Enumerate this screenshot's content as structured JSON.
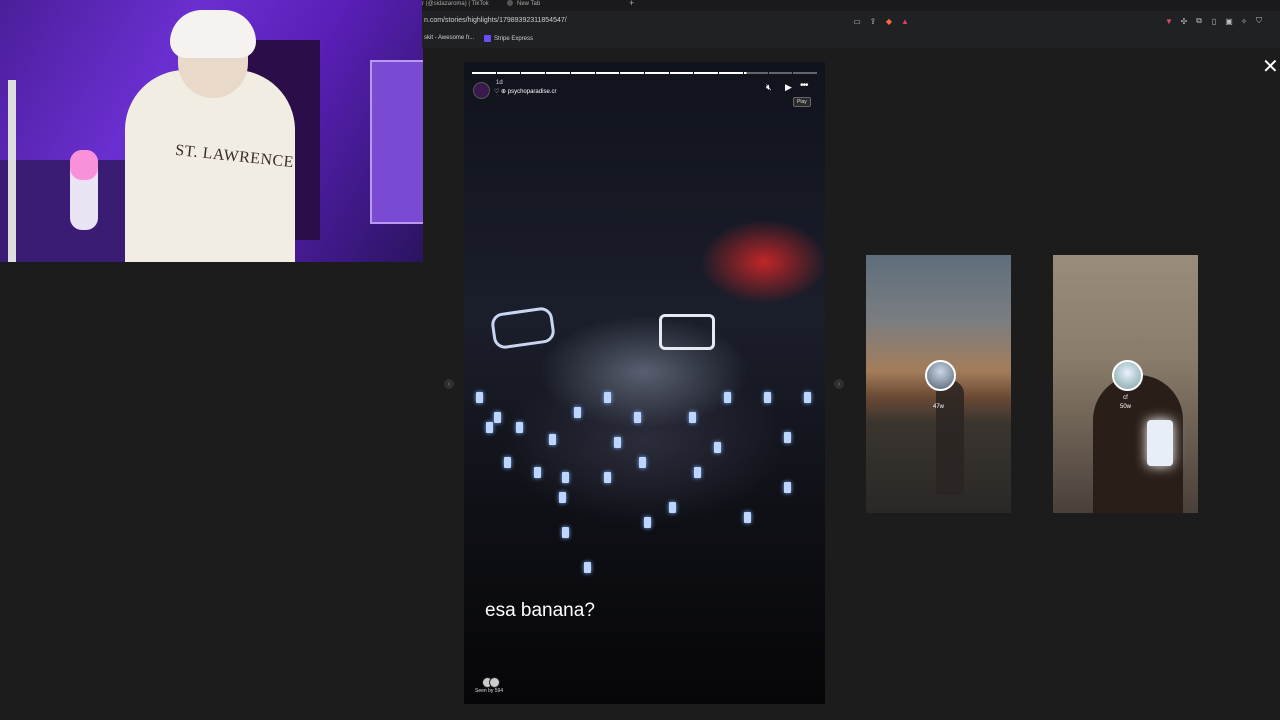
{
  "browser": {
    "tabs": [
      {
        "label": "r (@sidazaroma) | TikTok"
      },
      {
        "label": "New Tab"
      }
    ],
    "new_tab_glyph": "+",
    "url": "n.com/stories/highlights/17989392311854547/",
    "bookmarks": [
      {
        "label": "skit - Awesome fr..."
      },
      {
        "label": "Stripe Express"
      }
    ]
  },
  "story": {
    "time": "1d",
    "username": "psychoparadise.cr",
    "tooltip": "Play",
    "caption": "esa banana?",
    "seen_by": "Seen by 594",
    "progress": {
      "segments": 14,
      "completed": 11,
      "current_fraction": 0.1
    }
  },
  "previews": [
    {
      "time": "47w"
    },
    {
      "name": "cf",
      "time": "50w"
    }
  ],
  "close_glyph": "✕",
  "icons": [
    "close-icon",
    "mute-icon",
    "play-icon",
    "more-icon",
    "chevron-left-icon",
    "chevron-right-icon",
    "tiktok-icon",
    "stripe-icon"
  ],
  "colors": {
    "background": "#1c1c1c",
    "webcam_purple": "#6a2fd0",
    "stage_red": "#dc2828",
    "bookmark_accent": "#6b4df5"
  }
}
